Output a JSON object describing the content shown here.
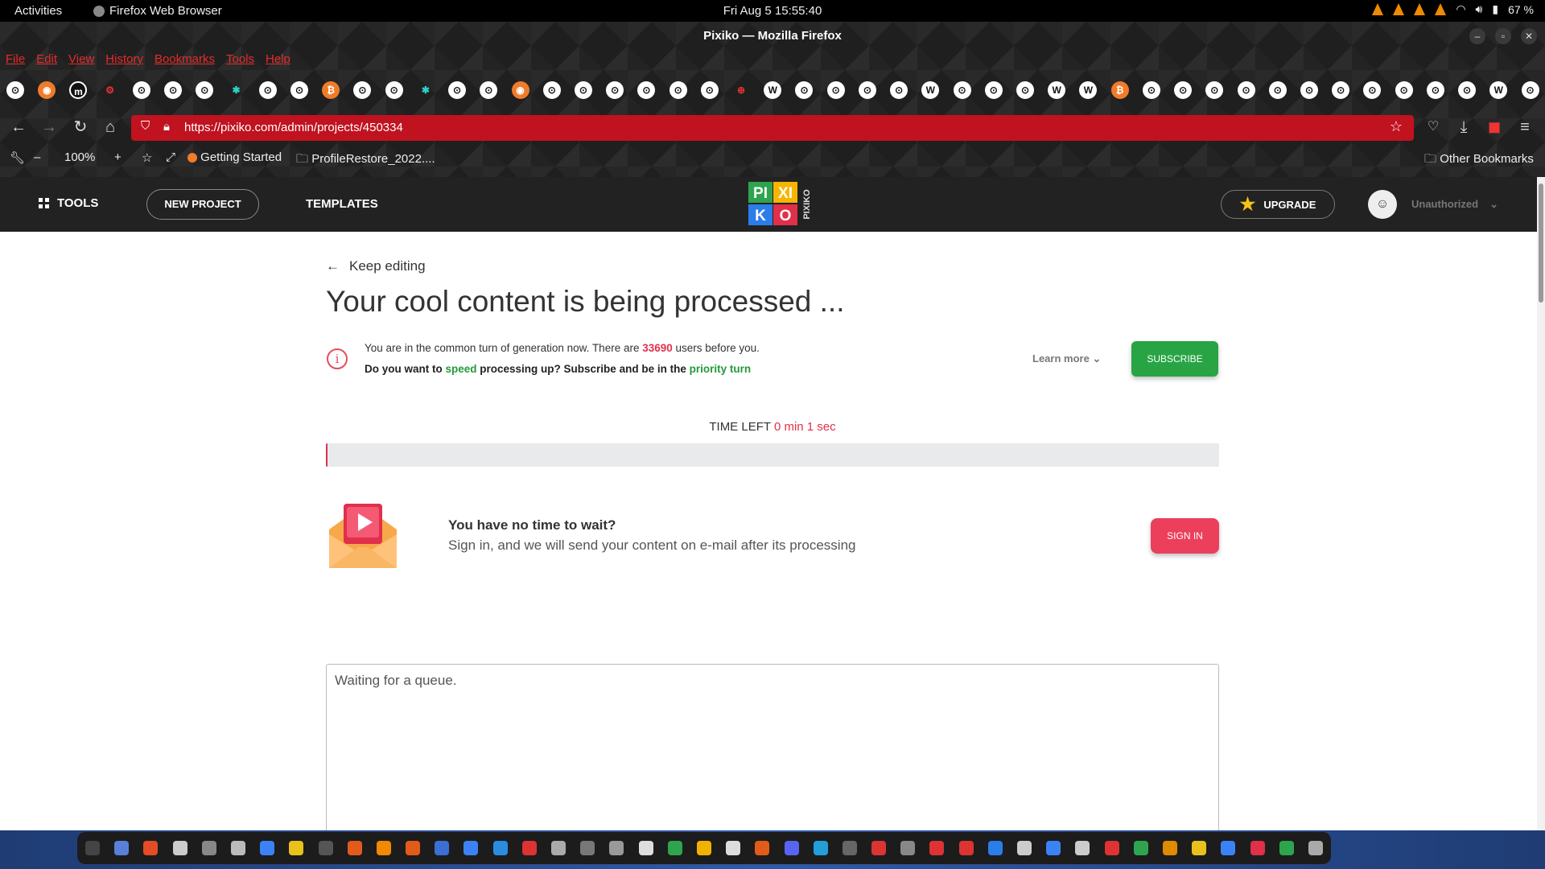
{
  "topbar": {
    "activities": "Activities",
    "app": "Firefox Web Browser",
    "clock": "Fri Aug 5  15:55:40",
    "battery": "67 %"
  },
  "window": {
    "title": "Pixiko — Mozilla Firefox"
  },
  "menu": [
    "File",
    "Edit",
    "View",
    "History",
    "Bookmarks",
    "Tools",
    "Help"
  ],
  "bookmark_icons": [
    "github-icon",
    "firefox-icon",
    "m-icon",
    "gear-icon",
    "github-icon",
    "github-icon",
    "github-icon",
    "puzzle-icon",
    "github-icon",
    "github-icon",
    "bitcoin-icon",
    "github-icon",
    "github-icon",
    "puzzle-icon",
    "github-icon",
    "github-icon",
    "firefox-icon",
    "github-icon",
    "github-icon",
    "github-icon",
    "github-icon",
    "github-icon",
    "github-icon",
    "globe-icon",
    "wiki-icon",
    "github-icon",
    "github-icon",
    "github-icon",
    "github-icon",
    "wiki-icon",
    "github-icon",
    "github-icon",
    "github-icon",
    "wiki-icon",
    "wiki-icon",
    "bitcoin-icon",
    "github-icon",
    "github-icon",
    "github-icon",
    "github-icon",
    "github-icon",
    "github-icon",
    "github-icon",
    "github-icon",
    "github-icon",
    "github-icon",
    "github-icon",
    "wiki-icon",
    "github-icon"
  ],
  "address": {
    "url": "https://pixiko.com/admin/projects/450334"
  },
  "toolbar2": {
    "zoom": "100%",
    "getting_started": "Getting Started",
    "profile_restore": "ProfileRestore_2022....",
    "other_bookmarks": "Other Bookmarks"
  },
  "site": {
    "tools": "TOOLS",
    "new_project": "NEW PROJECT",
    "templates": "TEMPLATES",
    "upgrade": "UPGRADE",
    "user": "Unauthorized",
    "logo_text": [
      "PI",
      "XI",
      "K",
      "O",
      "PIXIKO"
    ]
  },
  "main": {
    "keep_editing": "Keep editing",
    "title": "Your cool content is being processed ...",
    "queue_prefix": "You are in the common turn of generation now. There are ",
    "queue_count": "33690",
    "queue_suffix": " users before you.",
    "speed_a": "Do you want to ",
    "speed_b": "speed",
    "speed_c": " processing up? Subscribe and be in the ",
    "speed_d": "priority turn",
    "learn_more": "Learn more",
    "subscribe": "SUBSCRIBE",
    "time_left_label": "TIME LEFT ",
    "time_left_value": "0 min 1 sec",
    "progress": 0.002,
    "no_time_title": "You have no time to wait?",
    "no_time_text": "Sign in, and we will send your content on e-mail after its processing",
    "sign_in": "SIGN IN",
    "log_text": "Waiting for a queue."
  },
  "colors": {
    "accent_red": "#e0304a",
    "green": "#229a3a",
    "subscribe": "#28a444",
    "signin": "#eb3f5c",
    "urlbar": "#c1121f"
  }
}
